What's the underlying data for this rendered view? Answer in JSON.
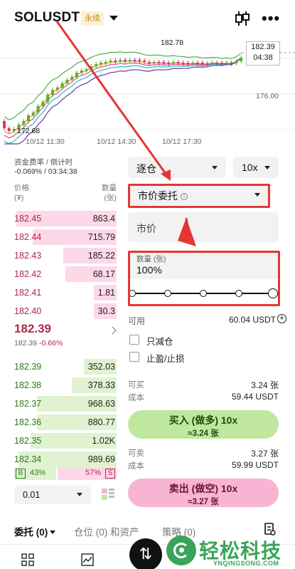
{
  "header": {
    "symbol": "SOLUSDT",
    "badge": "永续"
  },
  "chart": {
    "current_price": "182.39",
    "countdown": "04:38",
    "high_label": "182.78",
    "low_label": "172.68",
    "y_tick": "176.00",
    "x_ticks": [
      "10/12 11:30",
      "10/12 14:30",
      "10/12 17:30"
    ]
  },
  "funding": {
    "title": "资金费率 / 倒计时",
    "value": "-0.069% / 03:34:38"
  },
  "orderbook": {
    "price_header": "价格",
    "price_unit": "(₮)",
    "qty_header": "数量",
    "qty_unit": "(张)",
    "asks": [
      {
        "price": "182.45",
        "qty": "863.4",
        "depth": 0.98
      },
      {
        "price": "182.44",
        "qty": "715.79",
        "depth": 0.82
      },
      {
        "price": "182.43",
        "qty": "185.22",
        "depth": 0.52
      },
      {
        "price": "182.42",
        "qty": "68.17",
        "depth": 0.5
      },
      {
        "price": "182.41",
        "qty": "1.81",
        "depth": 0.22
      },
      {
        "price": "182.40",
        "qty": "30.3",
        "depth": 0.22
      }
    ],
    "last_price": "182.39",
    "last_sub_price": "182.39",
    "last_change": "-0.66%",
    "bids": [
      {
        "price": "182.39",
        "qty": "352.03",
        "depth": 0.32
      },
      {
        "price": "182.38",
        "qty": "378.33",
        "depth": 0.44
      },
      {
        "price": "182.37",
        "qty": "968.63",
        "depth": 0.78
      },
      {
        "price": "182.36",
        "qty": "880.77",
        "depth": 0.78
      },
      {
        "price": "182.35",
        "qty": "1.02K",
        "depth": 0.84
      },
      {
        "price": "182.34",
        "qty": "989.69",
        "depth": 0.96
      }
    ],
    "buy_label": "B",
    "buy_pct": "43%",
    "sell_pct": "57%",
    "sell_label": "S",
    "step": "0.01"
  },
  "form": {
    "margin_mode": "逐仓",
    "leverage": "10x",
    "order_type": "市价委托",
    "price_placeholder": "市价",
    "qty_label": "数量 (张)",
    "qty_value": "100%",
    "slider_value": 1.0,
    "avail_label": "可用",
    "avail_value": "60.04 USDT",
    "reduce_only": "只减仓",
    "tp_sl": "止盈/止损",
    "buy_can_label": "可买",
    "buy_can_value": "3.24 张",
    "buy_cost_label": "成本",
    "buy_cost_value": "59.44 USDT",
    "buy_button": "买入 (做多) 10x",
    "buy_button_sub": "≈3.24 张",
    "sell_can_label": "可卖",
    "sell_can_value": "3.27 张",
    "sell_cost_label": "成本",
    "sell_cost_value": "59.99 USDT",
    "sell_button": "卖出 (做空) 10x",
    "sell_button_sub": "≈3.27 张"
  },
  "tabs": {
    "orders": "委托 (0)",
    "positions": "仓位 (0) 和资产",
    "strategy": "策略 (0)"
  },
  "watermark": {
    "text": "轻松科技",
    "sub": "YNQINGSONG.COM"
  },
  "colors": {
    "ask": "#b0274a",
    "bid": "#2c7a1a",
    "annotation": "#e53535"
  }
}
